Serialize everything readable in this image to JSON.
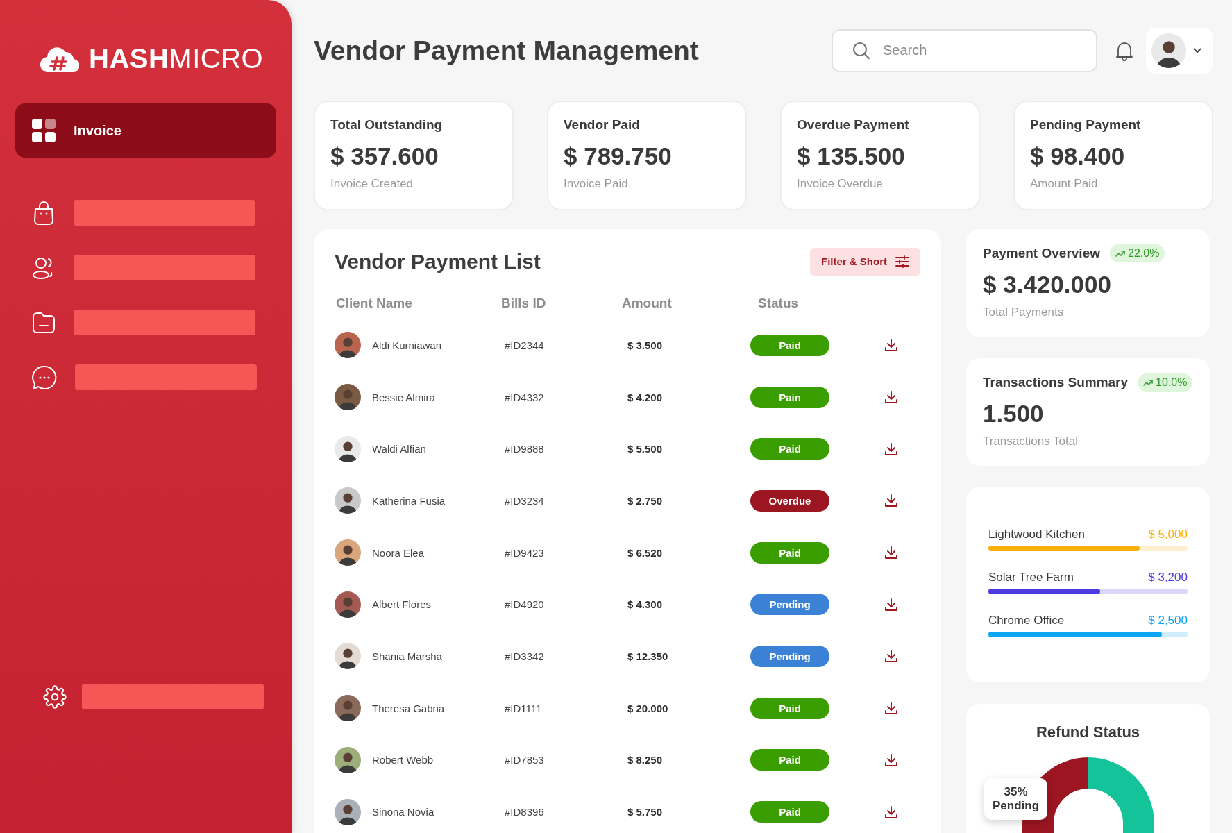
{
  "brand": {
    "name": "**HASH**MICRO"
  },
  "sidebar": {
    "items": [
      {
        "label": "Invoice",
        "selected": true
      },
      {
        "selected": false
      },
      {
        "selected": false
      },
      {
        "selected": false
      },
      {
        "selected": false
      }
    ]
  },
  "header": {
    "title": "Vendor Payment Management",
    "search": {
      "placeholder": "Search"
    }
  },
  "stats": [
    {
      "title": "Total Outstanding",
      "value": "$ 357.600",
      "caption": "Invoice Created"
    },
    {
      "title": "Vendor Paid",
      "value": "$ 789.750",
      "caption": "Invoice Paid"
    },
    {
      "title": "Overdue Payment",
      "value": "$ 135.500",
      "caption": "Invoice Overdue"
    },
    {
      "title": "Pending Payment",
      "value": "$ 98.400",
      "caption": "Amount Paid"
    }
  ],
  "table": {
    "title": "Vendor Payment List",
    "filter_button": "Filter & Short",
    "columns": [
      "Client Name",
      "Bills ID",
      "Amount",
      "Status"
    ],
    "rows": [
      {
        "client": "Aldi Kurniawan",
        "bill_id": "#ID2344",
        "amount": "$ 3.500",
        "status": "Paid",
        "kind": "paid"
      },
      {
        "client": "Bessie Almira",
        "bill_id": "#ID4332",
        "amount": "$ 4.200",
        "status": "Pain",
        "kind": "paid"
      },
      {
        "client": "Waldi Alfian",
        "bill_id": "#ID9888",
        "amount": "$ 5.500",
        "status": "Paid",
        "kind": "paid"
      },
      {
        "client": "Katherina Fusia",
        "bill_id": "#ID3234",
        "amount": "$ 2.750",
        "status": "Overdue",
        "kind": "overdue"
      },
      {
        "client": "Noora Elea",
        "bill_id": "#ID9423",
        "amount": "$ 6.520",
        "status": "Paid",
        "kind": "paid"
      },
      {
        "client": "Albert Flores",
        "bill_id": "#ID4920",
        "amount": "$ 4.300",
        "status": "Pending",
        "kind": "pending"
      },
      {
        "client": "Shania Marsha",
        "bill_id": "#ID3342",
        "amount": "$ 12.350",
        "status": "Pending",
        "kind": "pending"
      },
      {
        "client": "Theresa Gabria",
        "bill_id": "#ID1111",
        "amount": "$ 20.000",
        "status": "Paid",
        "kind": "paid"
      },
      {
        "client": "Robert Webb",
        "bill_id": "#ID7853",
        "amount": "$ 8.250",
        "status": "Paid",
        "kind": "paid"
      },
      {
        "client": "Sinona Novia",
        "bill_id": "#ID8396",
        "amount": "$ 5.750",
        "status": "Paid",
        "kind": "paid"
      }
    ]
  },
  "overview": [
    {
      "title": "Payment Overview",
      "change": "22.0%",
      "value": "$ 3.420.000",
      "caption": "Total Payments"
    },
    {
      "title": "Transactions Summary",
      "change": "10.0%",
      "value": "1.500",
      "caption": "Transactions Total"
    }
  ],
  "vendors": [
    {
      "name": "Lightwood Kitchen",
      "amount": "$ 5,000",
      "color": "#f9b208",
      "level": 0.76
    },
    {
      "name": "Solar Tree Farm",
      "amount": "$ 3,200",
      "color": "#4b3be0",
      "level": 0.56
    },
    {
      "name": "Chrome Office",
      "amount": "$ 2,500",
      "color": "#0ea5f5",
      "level": 0.87
    }
  ],
  "refund": {
    "title": "Refund Status",
    "callout_value": "35%",
    "callout_label": "Pending"
  }
}
